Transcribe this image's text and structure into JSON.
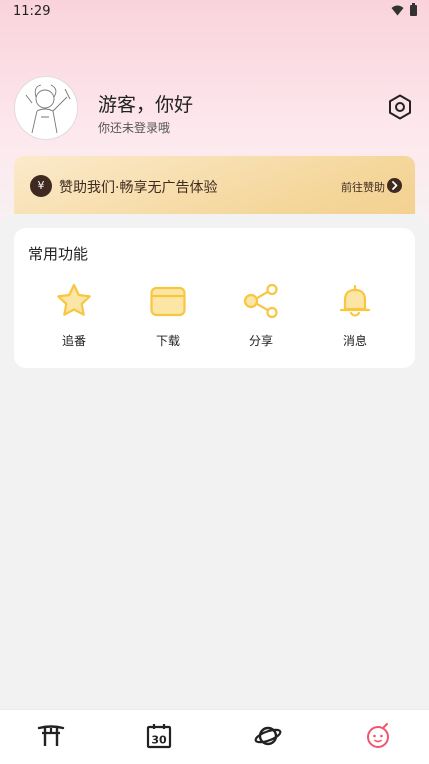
{
  "status_bar": {
    "time": "11:29",
    "icons": [
      "wifi-icon",
      "battery-icon"
    ]
  },
  "profile": {
    "username": "游客，你好",
    "login_hint": "你还未登录哦",
    "settings_icon": "settings-hexagon-icon"
  },
  "sponsor": {
    "icon": "¥",
    "text": "赞助我们·畅享无广告体验",
    "link_label": "前往赞助"
  },
  "functions": {
    "title": "常用功能",
    "items": [
      {
        "label": "追番",
        "icon": "star-icon"
      },
      {
        "label": "下载",
        "icon": "folder-icon"
      },
      {
        "label": "分享",
        "icon": "share-icon"
      },
      {
        "label": "消息",
        "icon": "bell-icon"
      }
    ]
  },
  "bottom_nav": {
    "items": [
      {
        "name": "home",
        "icon": "torii-gate-icon"
      },
      {
        "name": "calendar",
        "icon": "calendar-30-icon",
        "calendar_day": "30"
      },
      {
        "name": "discover",
        "icon": "planet-icon"
      },
      {
        "name": "profile",
        "icon": "mascot-face-icon",
        "active": true
      }
    ]
  },
  "colors": {
    "accent_yellow": "#f8c640",
    "light_yellow": "#fbe6a6",
    "active_red": "#f0566c",
    "sponsor_dark": "#3e2a20",
    "header_pink": "#f9d3dc"
  }
}
